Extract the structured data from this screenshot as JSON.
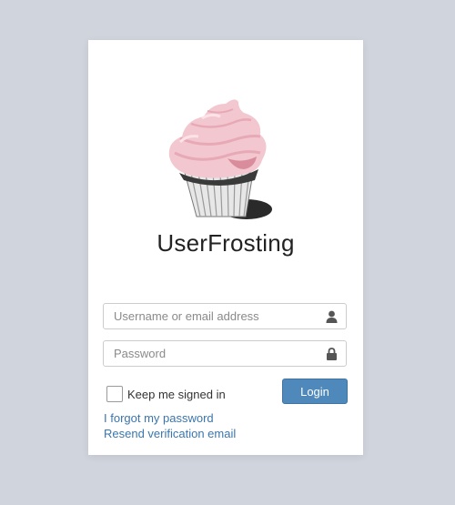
{
  "app": {
    "name": "UserFrosting",
    "logo_icon": "cupcake-logo-icon"
  },
  "form": {
    "username_placeholder": "Username or email address",
    "username_value": "",
    "username_icon": "user-icon",
    "password_placeholder": "Password",
    "password_value": "",
    "password_icon": "lock-icon",
    "remember_label": "Keep me signed in",
    "remember_checked": false,
    "login_label": "Login"
  },
  "links": {
    "forgot_password": "I forgot my password",
    "resend_verification": "Resend verification email"
  },
  "colors": {
    "background": "#d0d4dc",
    "card": "#ffffff",
    "primary_button": "#4f88ba",
    "link": "#3a76ad"
  }
}
